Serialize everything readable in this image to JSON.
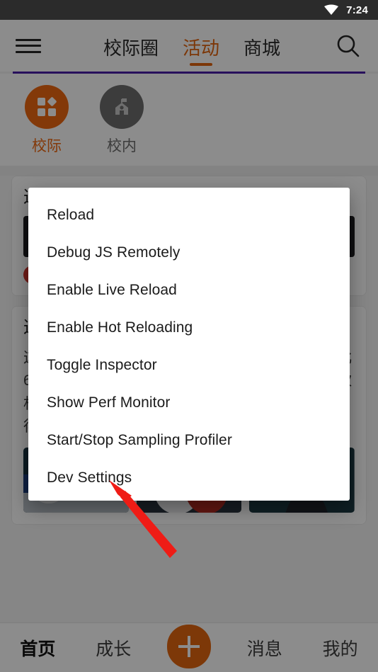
{
  "status_bar": {
    "time": "7:24",
    "wifi_icon": "wifi-icon"
  },
  "app": {
    "topbar": {
      "menu_icon": "hamburger-menu-icon",
      "search_icon": "search-icon",
      "tabs": [
        {
          "label": "校际圈",
          "active": false
        },
        {
          "label": "活动",
          "active": true
        },
        {
          "label": "商城",
          "active": false
        }
      ]
    },
    "categories": [
      {
        "label": "校际",
        "icon": "grid-blocks-icon",
        "active": true
      },
      {
        "label": "校内",
        "icon": "school-building-icon",
        "active": false
      }
    ],
    "feed": {
      "card_top": {
        "title": "这",
        "media_alt": "news-thumbnail"
      },
      "card_main": {
        "title": "这",
        "body": "这场欧洲杯比赛，葡萄牙坐看比利时踢，射门23比6，葡萄牙几乎4倍于比利时，可是对方只抓住一次机会，攻进葡萄牙大门，相反葡萄牙更多是得势不得分。",
        "thumbnails": [
          "match-photo-player-bowing",
          "match-photo-ronaldo-embrace",
          "match-photo-coach-santos"
        ]
      }
    },
    "bottom_nav": [
      {
        "label": "首页",
        "active": true
      },
      {
        "label": "成长",
        "active": false
      },
      {
        "label": "",
        "active": false,
        "icon": "plus-icon"
      },
      {
        "label": "消息",
        "active": false
      },
      {
        "label": "我的",
        "active": false
      }
    ]
  },
  "dev_menu": {
    "items": [
      "Reload",
      "Debug JS Remotely",
      "Enable Live Reload",
      "Enable Hot Reloading",
      "Toggle Inspector",
      "Show Perf Monitor",
      "Start/Stop Sampling Profiler",
      "Dev Settings"
    ]
  },
  "annotation": {
    "arrow_icon": "red-arrow-annotation",
    "color": "#ef1c16",
    "points_at": "Dev Settings"
  },
  "colors": {
    "accent_orange": "#ef6912",
    "accent_purple": "#4a1ea8",
    "status_bar_bg": "#2b2b2b",
    "dialog_bg": "#ffffff",
    "scrim": "rgba(0,0,0,0.45)"
  }
}
